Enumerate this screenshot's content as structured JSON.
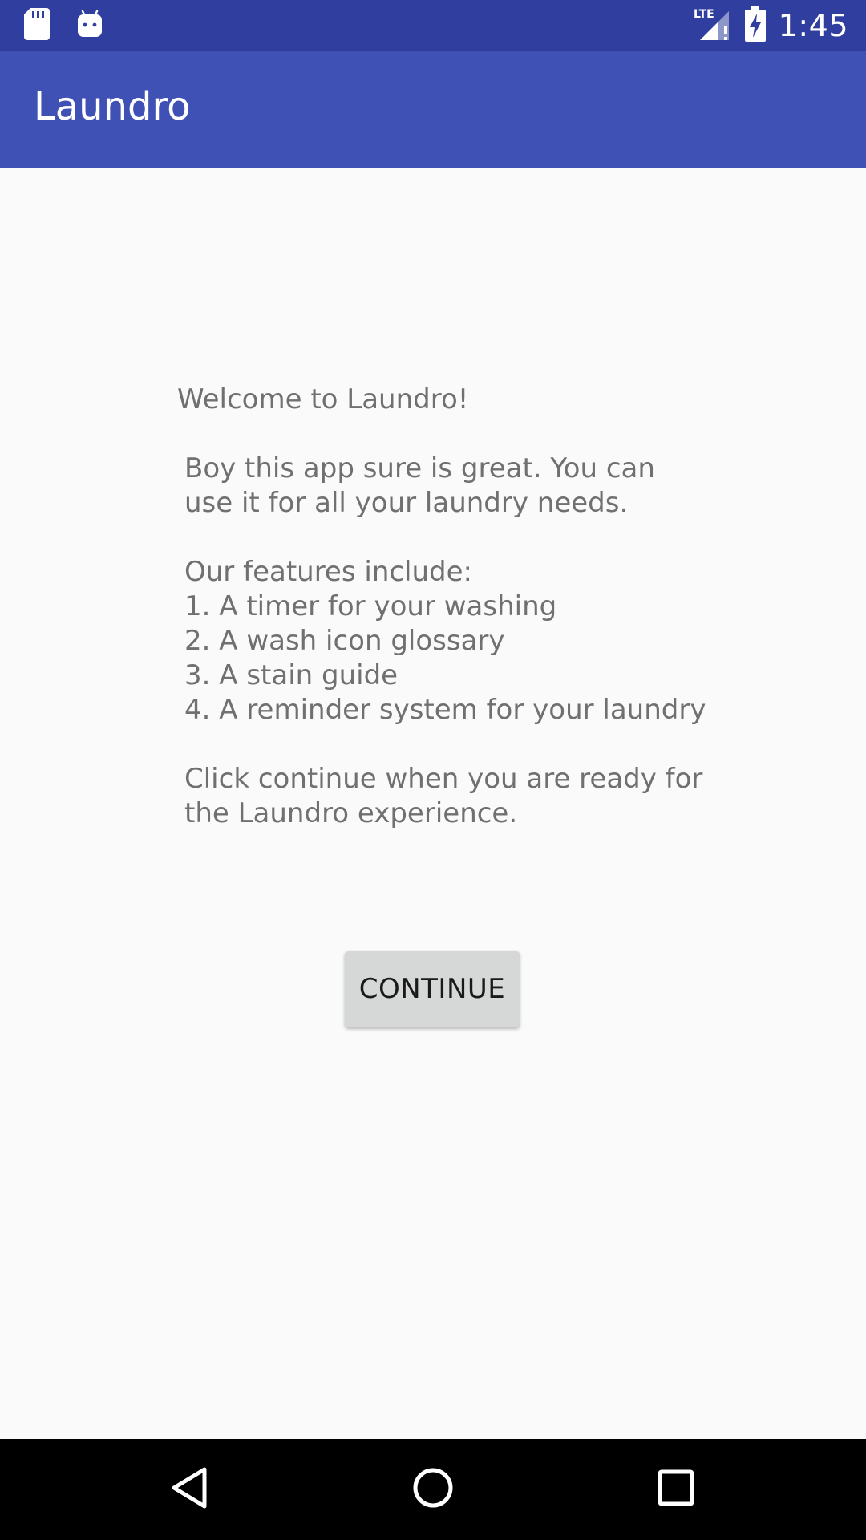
{
  "status_bar": {
    "time": "1:45",
    "icons": [
      "sd-card-icon",
      "android-icon",
      "lte-signal-icon",
      "battery-charging-icon"
    ],
    "network_label": "LTE"
  },
  "app_bar": {
    "title": "Laundro",
    "color": "#3F51B5",
    "status_color": "#303F9F"
  },
  "content": {
    "welcome": "Welcome to Laundro!",
    "intro_lines": [
      "Boy this app sure is great. You can",
      "use it for all your laundry needs."
    ],
    "features_heading": "Our features include:",
    "features": [
      "1. A timer for your washing",
      "2. A wash icon glossary",
      "3. A stain guide",
      "4. A reminder system for your laundry"
    ],
    "outro_lines": [
      "Click continue when you are ready for",
      "the Laundro experience."
    ],
    "continue_label": "CONTINUE"
  },
  "nav_bar": {
    "icons": [
      "back-icon",
      "home-icon",
      "recents-icon"
    ]
  }
}
